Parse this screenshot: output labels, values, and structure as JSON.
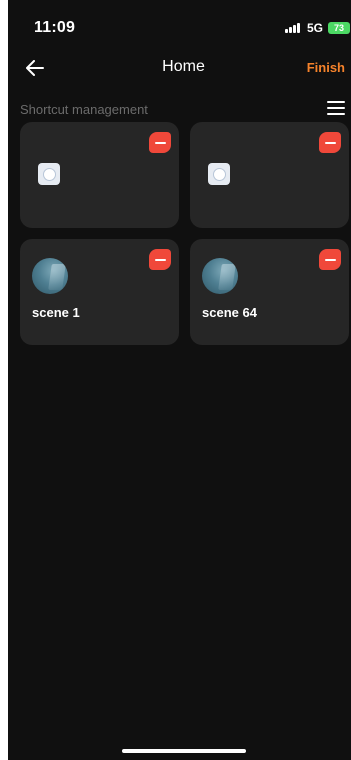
{
  "status_bar": {
    "time": "11:09",
    "network": "5G",
    "battery": "73"
  },
  "nav": {
    "title": "Home",
    "finish_label": "Finish",
    "back_icon": "arrow-left-icon"
  },
  "section": {
    "title": "Shortcut management",
    "menu_icon": "hamburger-menu-icon"
  },
  "cards": [
    {
      "type": "device",
      "icon": "thermostat-dial-icon",
      "label": ""
    },
    {
      "type": "device",
      "icon": "thermostat-dial-icon",
      "label": ""
    },
    {
      "type": "scene",
      "icon": "scene-avatar",
      "label": "scene 1"
    },
    {
      "type": "scene",
      "icon": "scene-avatar",
      "label": "scene 64"
    }
  ],
  "colors": {
    "background": "#101010",
    "card": "#262626",
    "accent": "#f5822b",
    "remove": "#f0483a",
    "battery": "#4cd964"
  }
}
